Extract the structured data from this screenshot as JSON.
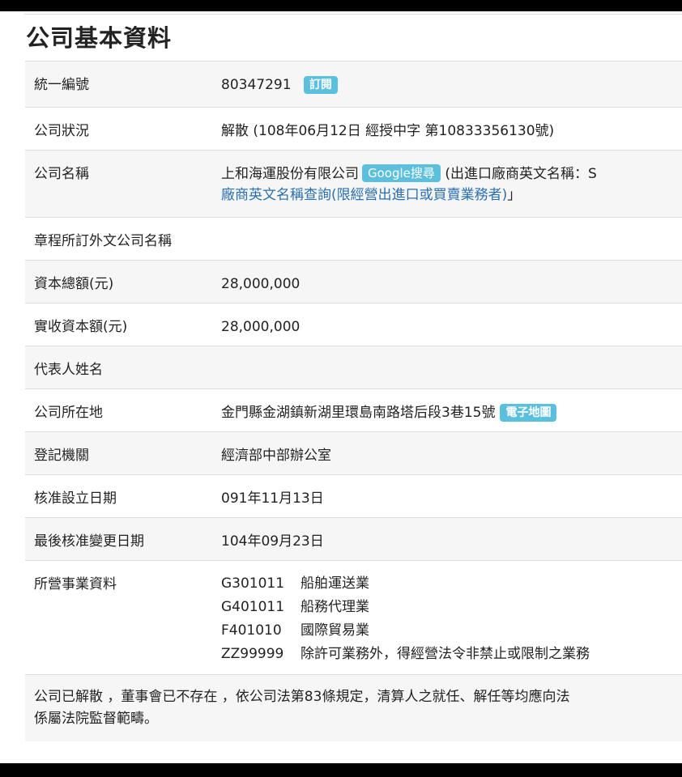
{
  "title": "公司基本資料",
  "rows": {
    "ubn": {
      "label": "統一編號",
      "value": "80347291",
      "subscribe_label": "訂閱"
    },
    "status": {
      "label": "公司狀況",
      "value": "解散 (108年06月12日 經授中字 第10833356130號)"
    },
    "name": {
      "label": "公司名稱",
      "value": "上和海運股份有限公司",
      "google_label": "Google搜尋",
      "english_prefix": "(出進口廠商英文名稱：S",
      "english_link": "廠商英文名稱查詢(限經營出進口或買賣業務者)",
      "english_suffix": "」"
    },
    "foreign_name": {
      "label": "章程所訂外文公司名稱",
      "value": ""
    },
    "capital_total": {
      "label": "資本總額(元)",
      "value": "28,000,000"
    },
    "capital_paid": {
      "label": "實收資本額(元)",
      "value": "28,000,000"
    },
    "representative": {
      "label": "代表人姓名",
      "value": ""
    },
    "address": {
      "label": "公司所在地",
      "value": "金門縣金湖鎮新湖里環島南路塔后段3巷15號",
      "map_label": "電子地圖"
    },
    "registry": {
      "label": "登記機關",
      "value": "經濟部中部辦公室"
    },
    "established": {
      "label": "核准設立日期",
      "value": "091年11月13日"
    },
    "last_change": {
      "label": "最後核准變更日期",
      "value": "104年09月23日"
    },
    "business": {
      "label": "所營事業資料",
      "items": [
        {
          "code": "G301011",
          "desc": "船舶運送業"
        },
        {
          "code": "G401011",
          "desc": "船務代理業"
        },
        {
          "code": "F401010",
          "desc": "國際貿易業"
        },
        {
          "code": "ZZ99999",
          "desc": "除許可業務外，得經營法令非禁止或限制之業務"
        }
      ]
    }
  },
  "notice": {
    "line1": "公司已解散 ，董事會已不存在 ，依公司法第83條規定，清算人之就任、解任等均應向法",
    "line2": "係屬法院監督範疇。"
  },
  "colors": {
    "badge": "#5bc0de",
    "link": "#2a6fb0",
    "row_odd": "#f6f6f6",
    "border": "#dddddd"
  }
}
